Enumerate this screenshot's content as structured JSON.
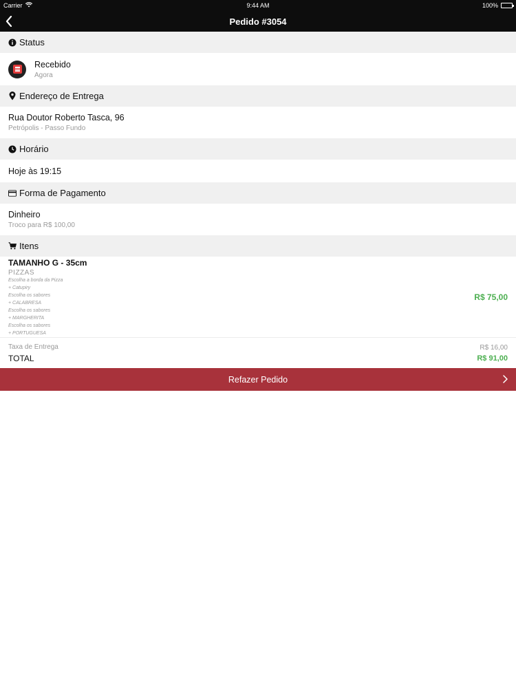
{
  "status_bar": {
    "carrier": "Carrier",
    "time": "9:44 AM",
    "battery": "100%",
    "battery_level": 1.0
  },
  "nav": {
    "title": "Pedido #3054",
    "back_icon": "chevron-left-icon"
  },
  "sections": {
    "status": {
      "header": "Status",
      "icon": "info-icon",
      "value": "Recebido",
      "sub": "Agora"
    },
    "address": {
      "header": "Endereço de Entrega",
      "icon": "map-pin-icon",
      "street": "Rua Doutor Roberto Tasca, 96",
      "district": "Petrópolis - Passo Fundo"
    },
    "time": {
      "header": "Horário",
      "icon": "clock-icon",
      "value": "Hoje às 19:15"
    },
    "payment": {
      "header": "Forma de Pagamento",
      "icon": "credit-card-icon",
      "method": "Dinheiro",
      "change": "Troco para R$ 100,00"
    },
    "items": {
      "header": "Itens",
      "icon": "cart-icon",
      "list": [
        {
          "name": "TAMANHO G - 35cm",
          "category": "PIZZAS",
          "price": "R$ 75,00",
          "options": [
            "Escolha a borda da Pizza",
            "+ Catupiry",
            "Escolha os sabores",
            "+ CALABRESA",
            "Escolha os sabores",
            "+ MARGHERITA",
            "Escolha os sabores",
            "+ PORTUGUESA"
          ]
        }
      ]
    }
  },
  "totals": {
    "fee_label": "Taxa de Entrega",
    "fee_value": "R$ 16,00",
    "total_label": "TOTAL",
    "total_value": "R$ 91,00"
  },
  "reorder_button": {
    "label": "Refazer Pedido",
    "icon": "chevron-right-icon"
  },
  "colors": {
    "header_bg": "#0d0d0d",
    "section_bg": "#f0f0f0",
    "price_green": "#4caf50",
    "button_red": "#a8323b",
    "status_red": "#e23b3b"
  }
}
